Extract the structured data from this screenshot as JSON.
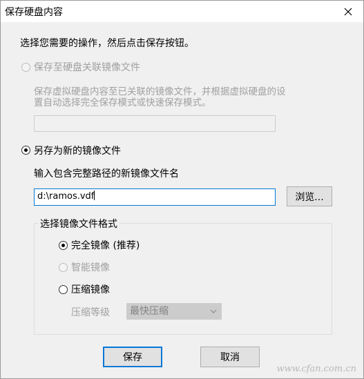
{
  "window": {
    "title": "保存硬盘内容"
  },
  "instruction": "选择您需要的操作，然后点击保存按钮。",
  "option_associated": {
    "label": "保存至硬盘关联镜像文件",
    "description_line1": "保存虚拟硬盘内容至已关联的镜像文件，并根据虚拟硬盘的设",
    "description_line2": "置自动选择完全保存模式或快速保存模式。",
    "path_value": "",
    "selected": false,
    "enabled": false
  },
  "option_new": {
    "label": "另存为新的镜像文件",
    "selected": true,
    "path_label": "输入包含完整路径的新镜像文件名",
    "path_value": "d:\\ramos.vdf",
    "browse_label": "浏览..."
  },
  "format_group": {
    "legend": "选择镜像文件格式",
    "options": [
      {
        "label": "完全镜像 (推荐)",
        "selected": true,
        "enabled": true
      },
      {
        "label": "智能镜像",
        "selected": false,
        "enabled": false
      },
      {
        "label": "压缩镜像",
        "selected": false,
        "enabled": true
      }
    ],
    "compression_label": "压缩等级",
    "compression_value": "最快压缩"
  },
  "buttons": {
    "save_label": "保存",
    "cancel_label": "取消"
  },
  "watermark": "www.cfan.com.cn",
  "colors": {
    "accent": "#0078d7",
    "dialog_bg": "#f0f0f0",
    "disabled_text": "#a0a0a0"
  }
}
